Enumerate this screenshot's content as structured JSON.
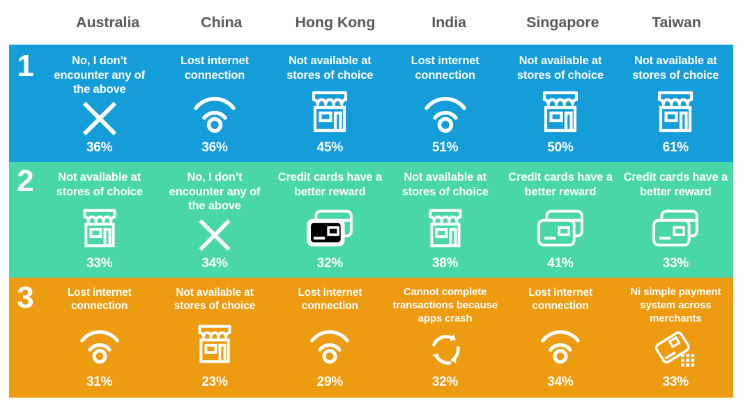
{
  "header": {
    "rank_column_label": "",
    "countries": [
      "Australia",
      "China",
      "Hong Kong",
      "India",
      "Singapore",
      "Taiwan"
    ]
  },
  "colors": {
    "row1": "#159DD9",
    "row2": "#4AD7A8",
    "row3": "#ED9B11",
    "header_text": "#5A5A5A",
    "cell_text": "#FFFFFF",
    "background": "#FFFFFF"
  },
  "rows": [
    {
      "rank": "1",
      "color": "#159DD9",
      "cells": [
        {
          "label": "No, I don’t encounter any of the above",
          "icon": "cross-icon",
          "value": "36%"
        },
        {
          "label": "Lost internet connection",
          "icon": "wifi-icon",
          "value": "36%"
        },
        {
          "label": "Not available at stores of choice",
          "icon": "storefront-icon",
          "value": "45%"
        },
        {
          "label": "Lost internet connection",
          "icon": "wifi-icon",
          "value": "51%"
        },
        {
          "label": "Not available at stores of choice",
          "icon": "storefront-icon",
          "value": "50%"
        },
        {
          "label": "Not available at stores of choice",
          "icon": "storefront-icon",
          "value": "61%"
        }
      ]
    },
    {
      "rank": "2",
      "color": "#4AD7A8",
      "cells": [
        {
          "label": "Not available at stores of choice",
          "icon": "storefront-icon",
          "value": "33%"
        },
        {
          "label": "No, I don’t encounter any of the above",
          "icon": "cross-icon",
          "value": "34%"
        },
        {
          "label": "Credit cards have a better reward",
          "icon": "credit-cards-icon",
          "value": "32%"
        },
        {
          "label": "Not available at stores of choice",
          "icon": "storefront-icon",
          "value": "38%"
        },
        {
          "label": "Credit cards have a better reward",
          "icon": "credit-cards-icon",
          "value": "41%"
        },
        {
          "label": "Credit cards have a better reward",
          "icon": "credit-cards-icon",
          "value": "33%"
        }
      ]
    },
    {
      "rank": "3",
      "color": "#ED9B11",
      "cells": [
        {
          "label": "Lost internet connection",
          "icon": "wifi-icon",
          "value": "31%"
        },
        {
          "label": "Not available at stores of choice",
          "icon": "storefront-icon",
          "value": "23%"
        },
        {
          "label": "Lost internet connection",
          "icon": "wifi-icon",
          "value": "29%"
        },
        {
          "label": "Cannot complete transactions because apps crash",
          "icon": "refresh-cycle-icon",
          "value": "32%"
        },
        {
          "label": "Lost internet connection",
          "icon": "wifi-icon",
          "value": "34%"
        },
        {
          "label": "Ni simple payment system across merchants",
          "icon": "contactless-card-icon",
          "value": "33%"
        }
      ]
    }
  ],
  "chart_data": {
    "type": "table",
    "title": "",
    "categories": [
      "Australia",
      "China",
      "Hong Kong",
      "India",
      "Singapore",
      "Taiwan"
    ],
    "row_labels": [
      "1",
      "2",
      "3"
    ],
    "cells": [
      [
        {
          "label": "No, I don’t encounter any of the above",
          "value": 36
        },
        {
          "label": "Lost internet connection",
          "value": 36
        },
        {
          "label": "Not available at stores of choice",
          "value": 45
        },
        {
          "label": "Lost internet connection",
          "value": 51
        },
        {
          "label": "Not available at stores of choice",
          "value": 50
        },
        {
          "label": "Not available at stores of choice",
          "value": 61
        }
      ],
      [
        {
          "label": "Not available at stores of choice",
          "value": 33
        },
        {
          "label": "No, I don’t encounter any of the above",
          "value": 34
        },
        {
          "label": "Credit cards have a better reward",
          "value": 32
        },
        {
          "label": "Not available at stores of choice",
          "value": 38
        },
        {
          "label": "Credit cards have a better reward",
          "value": 41
        },
        {
          "label": "Credit cards have a better reward",
          "value": 33
        }
      ],
      [
        {
          "label": "Lost internet connection",
          "value": 31
        },
        {
          "label": "Not available at stores of choice",
          "value": 23
        },
        {
          "label": "Lost internet connection",
          "value": 29
        },
        {
          "label": "Cannot complete transactions because apps crash",
          "value": 32
        },
        {
          "label": "Lost internet connection",
          "value": 34
        },
        {
          "label": "Ni simple payment system across merchants",
          "value": 33
        }
      ]
    ],
    "units": "percent"
  }
}
